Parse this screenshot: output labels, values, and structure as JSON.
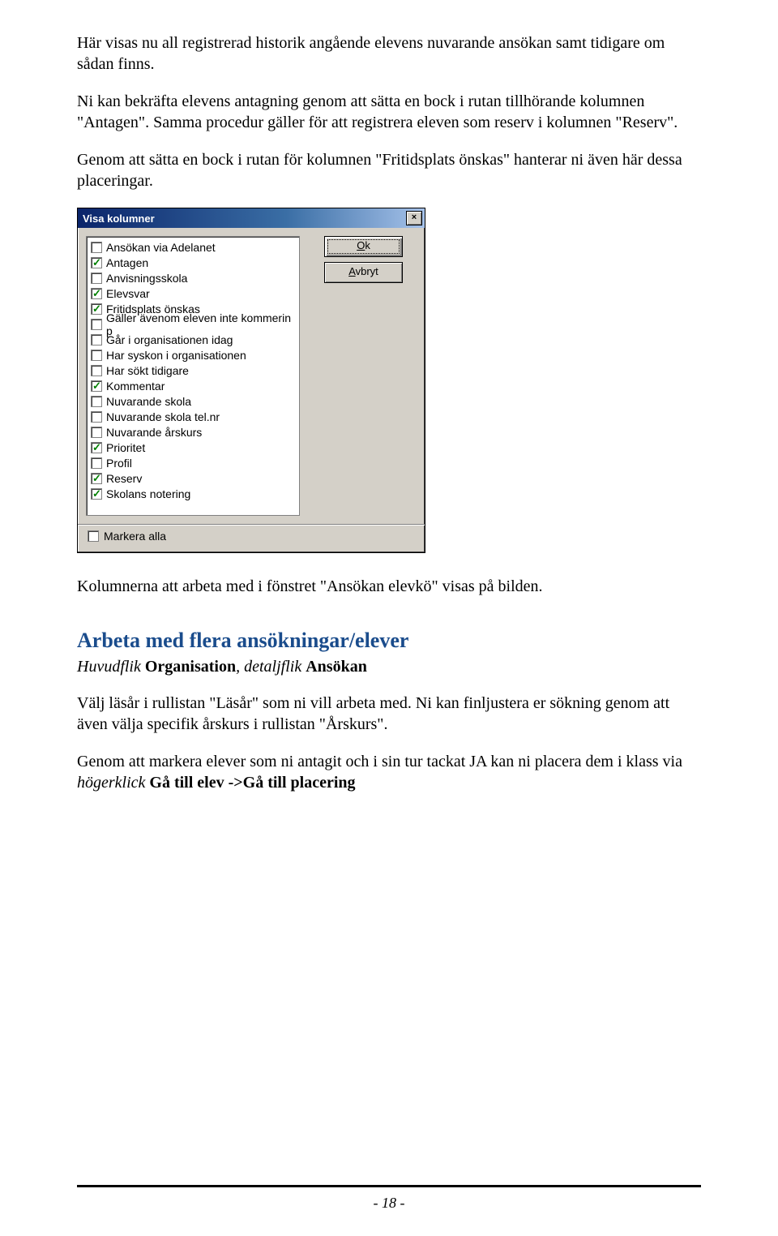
{
  "body": {
    "p1": "Här visas nu all registrerad historik angående elevens nuvarande ansökan samt tidigare om sådan finns.",
    "p2": "Ni kan bekräfta elevens antagning genom att sätta en bock i rutan tillhörande kolumnen \"Antagen\". Samma procedur gäller för att registrera eleven som reserv i kolumnen \"Reserv\".",
    "p3": "Genom att sätta en bock i rutan för kolumnen \"Fritidsplats önskas\" hanterar ni även här dessa placeringar.",
    "caption": "Kolumnerna att arbeta med i fönstret \"Ansökan elevkö\" visas på bilden.",
    "h2": "Arbeta med flera ansökningar/elever",
    "sub_pre": "Huvudflik ",
    "sub_b1": "Organisation",
    "sub_mid": ", detaljflik ",
    "sub_b2": "Ansökan",
    "p4": "Välj läsår i rullistan \"Läsår\" som ni vill arbeta med. Ni kan finljustera er sökning genom att även välja specifik årskurs i rullistan \"Årskurs\".",
    "p5_a": "Genom att markera elever som ni antagit och i sin tur tackat JA kan ni placera dem i klass via ",
    "p5_i": "högerklick ",
    "p5_b": "Gå till elev ->Gå till placering"
  },
  "dialog": {
    "title": "Visa kolumner",
    "ok_u": "O",
    "ok_rest": "k",
    "avbryt_u": "A",
    "avbryt_rest": "vbryt",
    "markera_alla": "Markera alla",
    "items": [
      {
        "label": "Ansökan via Adelanet",
        "checked": false
      },
      {
        "label": "Antagen",
        "checked": true
      },
      {
        "label": "Anvisningsskola",
        "checked": false
      },
      {
        "label": "Elevsvar",
        "checked": true
      },
      {
        "label": "Fritidsplats önskas",
        "checked": true
      },
      {
        "label": "Gäller ävenom eleven inte kommerin p",
        "checked": false
      },
      {
        "label": "Går i organisationen idag",
        "checked": false
      },
      {
        "label": "Har syskon i organisationen",
        "checked": false
      },
      {
        "label": "Har sökt tidigare",
        "checked": false
      },
      {
        "label": "Kommentar",
        "checked": true
      },
      {
        "label": "Nuvarande skola",
        "checked": false
      },
      {
        "label": "Nuvarande skola tel.nr",
        "checked": false
      },
      {
        "label": "Nuvarande årskurs",
        "checked": false
      },
      {
        "label": "Prioritet",
        "checked": true
      },
      {
        "label": "Profil",
        "checked": false
      },
      {
        "label": "Reserv",
        "checked": true
      },
      {
        "label": "Skolans notering",
        "checked": true
      }
    ]
  },
  "footer": {
    "page": "- 18 -"
  }
}
